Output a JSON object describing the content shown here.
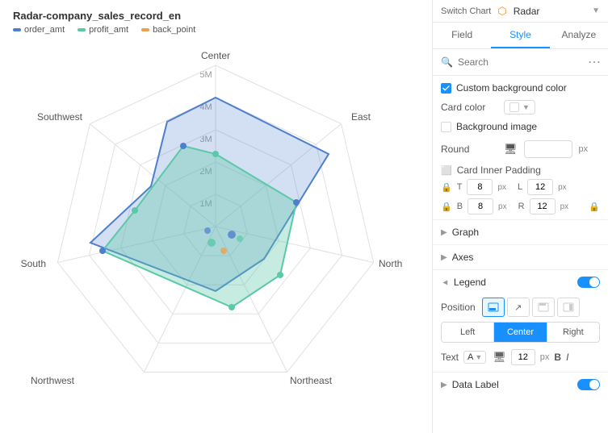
{
  "chart": {
    "title": "Radar-company_sales_record_en",
    "legend": {
      "items": [
        {
          "label": "order_amt",
          "color": "#4e7fcc"
        },
        {
          "label": "profit_amt",
          "color": "#5bc8a8"
        },
        {
          "label": "back_point",
          "color": "#f0a04b"
        }
      ]
    },
    "axes": [
      "Center",
      "East",
      "North",
      "Northeast",
      "Northwest",
      "South",
      "Southwest"
    ],
    "series": [
      {
        "name": "order_amt",
        "color": "rgba(100,149,220,0.5)",
        "stroke": "#4e7fcc"
      },
      {
        "name": "profit_amt",
        "color": "rgba(91,200,168,0.3)",
        "stroke": "#5bc8a8"
      }
    ]
  },
  "panel": {
    "switch_chart_label": "Switch Chart",
    "chart_type_icon": "⬡",
    "chart_type": "Radar",
    "tabs": [
      {
        "label": "Field",
        "active": false
      },
      {
        "label": "Style",
        "active": true
      },
      {
        "label": "Analyze",
        "active": false
      }
    ],
    "search": {
      "placeholder": "Search",
      "value": ""
    },
    "style": {
      "custom_bg_color_label": "Custom background color",
      "card_color_label": "Card color",
      "bg_image_label": "Background image",
      "round_label": "Round",
      "round_value": "",
      "round_unit": "px",
      "card_inner_padding_label": "Card Inner Padding",
      "padding": {
        "T": "8",
        "L": "12",
        "B": "8",
        "R": "12"
      },
      "padding_unit": "px",
      "sections": [
        {
          "label": "Graph",
          "expanded": false,
          "has_toggle": false
        },
        {
          "label": "Axes",
          "expanded": false,
          "has_toggle": false
        },
        {
          "label": "Legend",
          "expanded": true,
          "has_toggle": true
        },
        {
          "label": "Data Label",
          "expanded": false,
          "has_toggle": true
        }
      ],
      "legend": {
        "position_label": "Position",
        "position_buttons": [
          "Left",
          "Center",
          "Right"
        ],
        "active_position": "Center",
        "text_label": "Text",
        "font_text_option": "A",
        "font_size": "12",
        "font_size_unit": "px",
        "bold_label": "B",
        "italic_label": "I"
      }
    }
  }
}
